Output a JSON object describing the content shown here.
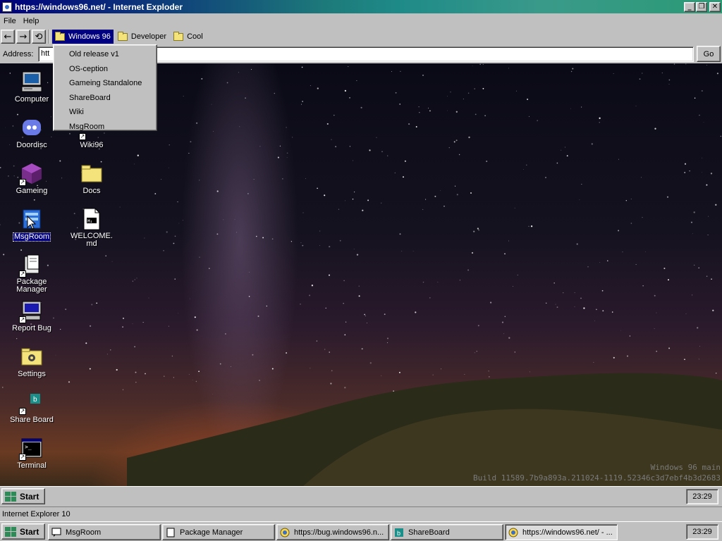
{
  "window": {
    "title": "https://windows96.net/ - Internet Exploder",
    "minimize_icon": "_",
    "restore_icon": "❐",
    "close_icon": "✕"
  },
  "menu": [
    "File",
    "Help"
  ],
  "toolbar": {
    "back_icon": "←",
    "forward_icon": "→",
    "refresh_icon": "⟲",
    "bookmarks": [
      "Windows 96",
      "Developer",
      "Cool"
    ]
  },
  "address": {
    "label": "Address:",
    "value": "htt",
    "go_label": "Go"
  },
  "dropdown": [
    "Old release v1",
    "OS-ception",
    "Gameing Standalone",
    "ShareBoard",
    "Wiki",
    "MsgRoom"
  ],
  "desktop": {
    "icons": [
      {
        "label": "Computer"
      },
      {
        "label": "Doordisc"
      },
      {
        "label": "Gameing"
      },
      {
        "label": "MsgRoom"
      },
      {
        "label": "Package Manager"
      },
      {
        "label": "Report Bug"
      },
      {
        "label": "Settings"
      },
      {
        "label": "Share Board"
      },
      {
        "label": "Terminal"
      },
      {
        "label": "Wiki96"
      },
      {
        "label": "Docs"
      },
      {
        "label": "WELCOME.md"
      }
    ],
    "build_line1": "Windows 96 main",
    "build_line2": "Build 11589.7b9a893a.211024-1119.52346c3d7ebf4b3d2683"
  },
  "inner_taskbar": {
    "start_label": "Start",
    "clock": "23:29"
  },
  "status": "Internet Explorer 10",
  "outer_taskbar": {
    "start_label": "Start",
    "clock": "23:29",
    "tasks": [
      "MsgRoom",
      "Package Manager",
      "https://bug.windows96.n...",
      "ShareBoard",
      "https://windows96.net/ - ..."
    ]
  },
  "colors": {
    "title_gradient_start": "#00007b",
    "title_gradient_end": "#2b9a75",
    "selection": "#000080",
    "chrome": "#c0c0c0"
  }
}
